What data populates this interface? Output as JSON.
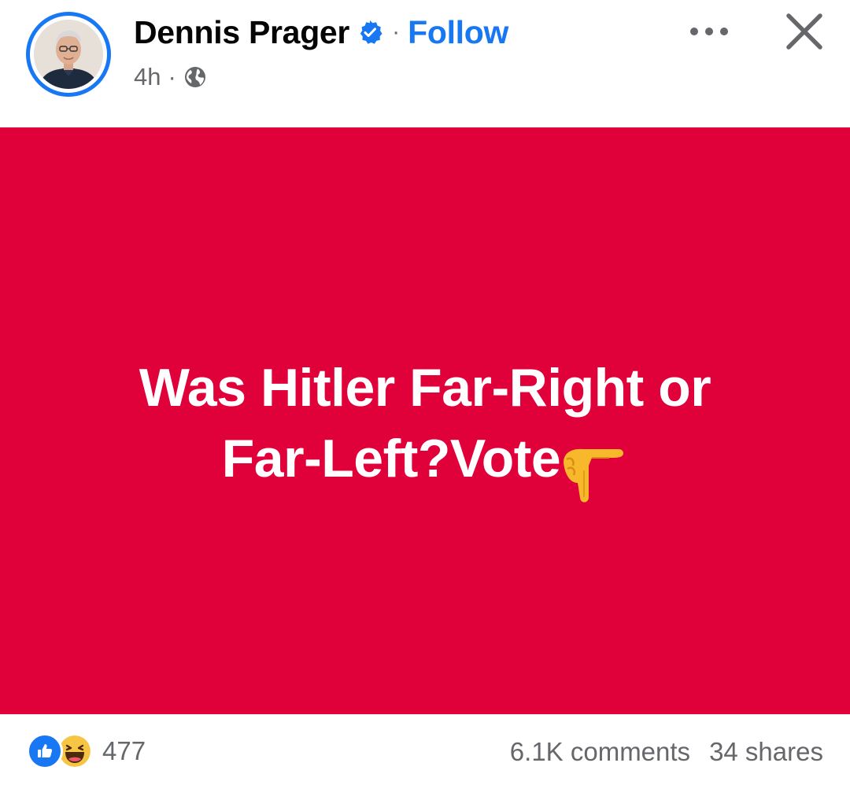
{
  "post": {
    "author": "Dennis Prager",
    "verified_icon": "verified-badge-icon",
    "separator": "·",
    "follow_label": "Follow",
    "timestamp": "4h",
    "meta_separator": "·",
    "audience_icon": "globe-icon",
    "more_icon": "more-options-icon",
    "close_icon": "close-icon"
  },
  "image": {
    "background_color": "#e0003a",
    "text_line1": "Was Hitler Far-Right or",
    "text_line2": "Far-Left?Vote",
    "emoji": "pointing-down-hand-icon"
  },
  "stats": {
    "reaction_icons": [
      "like-reaction-icon",
      "haha-reaction-icon"
    ],
    "reaction_count": "477",
    "comments": "6.1K comments",
    "shares": "34 shares"
  },
  "colors": {
    "accent": "#1877f2",
    "secondary_text": "#65676b"
  }
}
